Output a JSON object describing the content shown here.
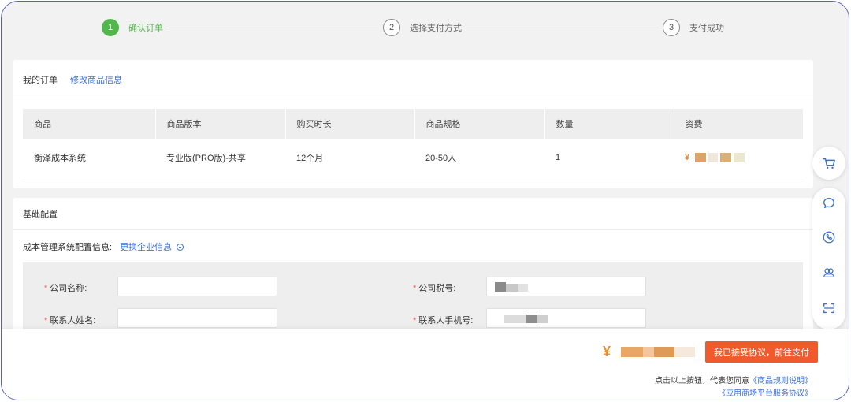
{
  "stepper": {
    "steps": [
      {
        "num": "1",
        "label": "确认订单",
        "active": true
      },
      {
        "num": "2",
        "label": "选择支付方式",
        "active": false
      },
      {
        "num": "3",
        "label": "支付成功",
        "active": false
      }
    ]
  },
  "order": {
    "title": "我的订单",
    "modify_link": "修改商品信息",
    "columns": [
      "商品",
      "商品版本",
      "购买时长",
      "商品规格",
      "数量",
      "资费"
    ],
    "row": {
      "product": "衡泽成本系统",
      "version": "专业版(PRO版)-共享",
      "duration": "12个月",
      "spec": "20-50人",
      "quantity": "1",
      "price_symbol": "¥"
    }
  },
  "config": {
    "title": "基础配置",
    "info_label": "成本管理系统配置信息:",
    "change_link": "更换企业信息",
    "fields": {
      "company_name": {
        "required": "*",
        "label": "公司名称:"
      },
      "tax_id": {
        "required": "*",
        "label": "公司税号:"
      },
      "contact_name": {
        "required": "*",
        "label": "联系人姓名:"
      },
      "contact_phone": {
        "required": "*",
        "label": "联系人手机号:"
      }
    }
  },
  "footer": {
    "total_symbol": "¥",
    "pay_button": "我已接受协议，前往支付",
    "agree_text": "点击以上按钮，代表您同意",
    "rule_link": "《商品规则说明》",
    "service_link": "《应用商场平台服务协议》"
  },
  "colors": {
    "accent_green": "#52b84d",
    "link_blue": "#3a6fd8",
    "pay_orange": "#f05a2c",
    "price_orange": "#e8902f",
    "required_red": "#e85a4f"
  }
}
